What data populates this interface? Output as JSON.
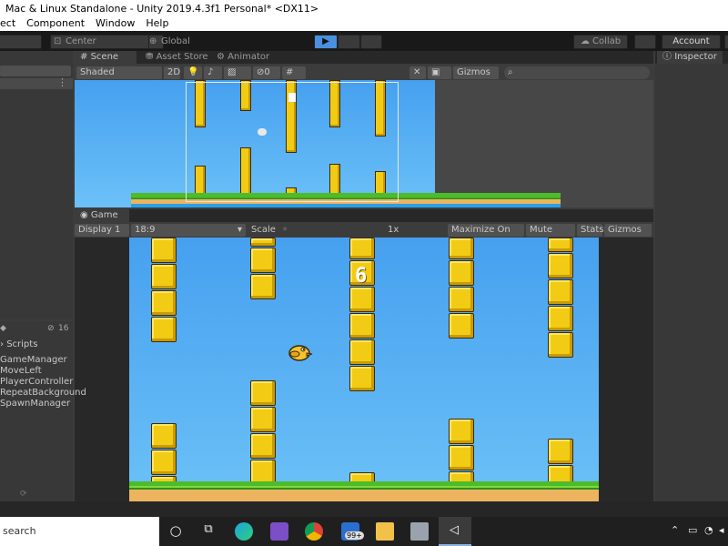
{
  "window": {
    "title": "Mac & Linux Standalone - Unity 2019.4.3f1 Personal* <DX11>"
  },
  "menu": [
    "ect",
    "Component",
    "Window",
    "Help"
  ],
  "toolbar": {
    "center_label": "Center",
    "global_label": "Global",
    "collab_label": "Collab",
    "account_label": "Account"
  },
  "scene_panel": {
    "tabs": [
      "Scene",
      "Asset Store",
      "Animator"
    ],
    "shading_mode": "Shaded",
    "mode_2d": "2D",
    "gizmos_label": "Gizmos",
    "hidden_count": "0"
  },
  "inspector": {
    "tab": "Inspector"
  },
  "game_panel": {
    "tab": "Game",
    "display": "Display 1",
    "aspect": "18:9",
    "scale_label": "Scale",
    "scale_value": "1x",
    "maximize_label": "Maximize On Play",
    "mute_label": "Mute Audio",
    "stats_label": "Stats",
    "gizmos_label": "Gizmos",
    "score": "6"
  },
  "project_panel": {
    "count": "16",
    "breadcrumb": "Scripts",
    "files": [
      "GameManager",
      "MoveLeft",
      "PlayerController",
      "RepeatBackground",
      "SpawnManager"
    ]
  },
  "taskbar": {
    "search_text": "search",
    "mail_badge": "99+"
  },
  "colors": {
    "sky_top": "#46a0ef",
    "pipe": "#f2cc14",
    "grass": "#4cbc2c",
    "dirt": "#edb460",
    "play_accent": "#4a8fe0"
  }
}
